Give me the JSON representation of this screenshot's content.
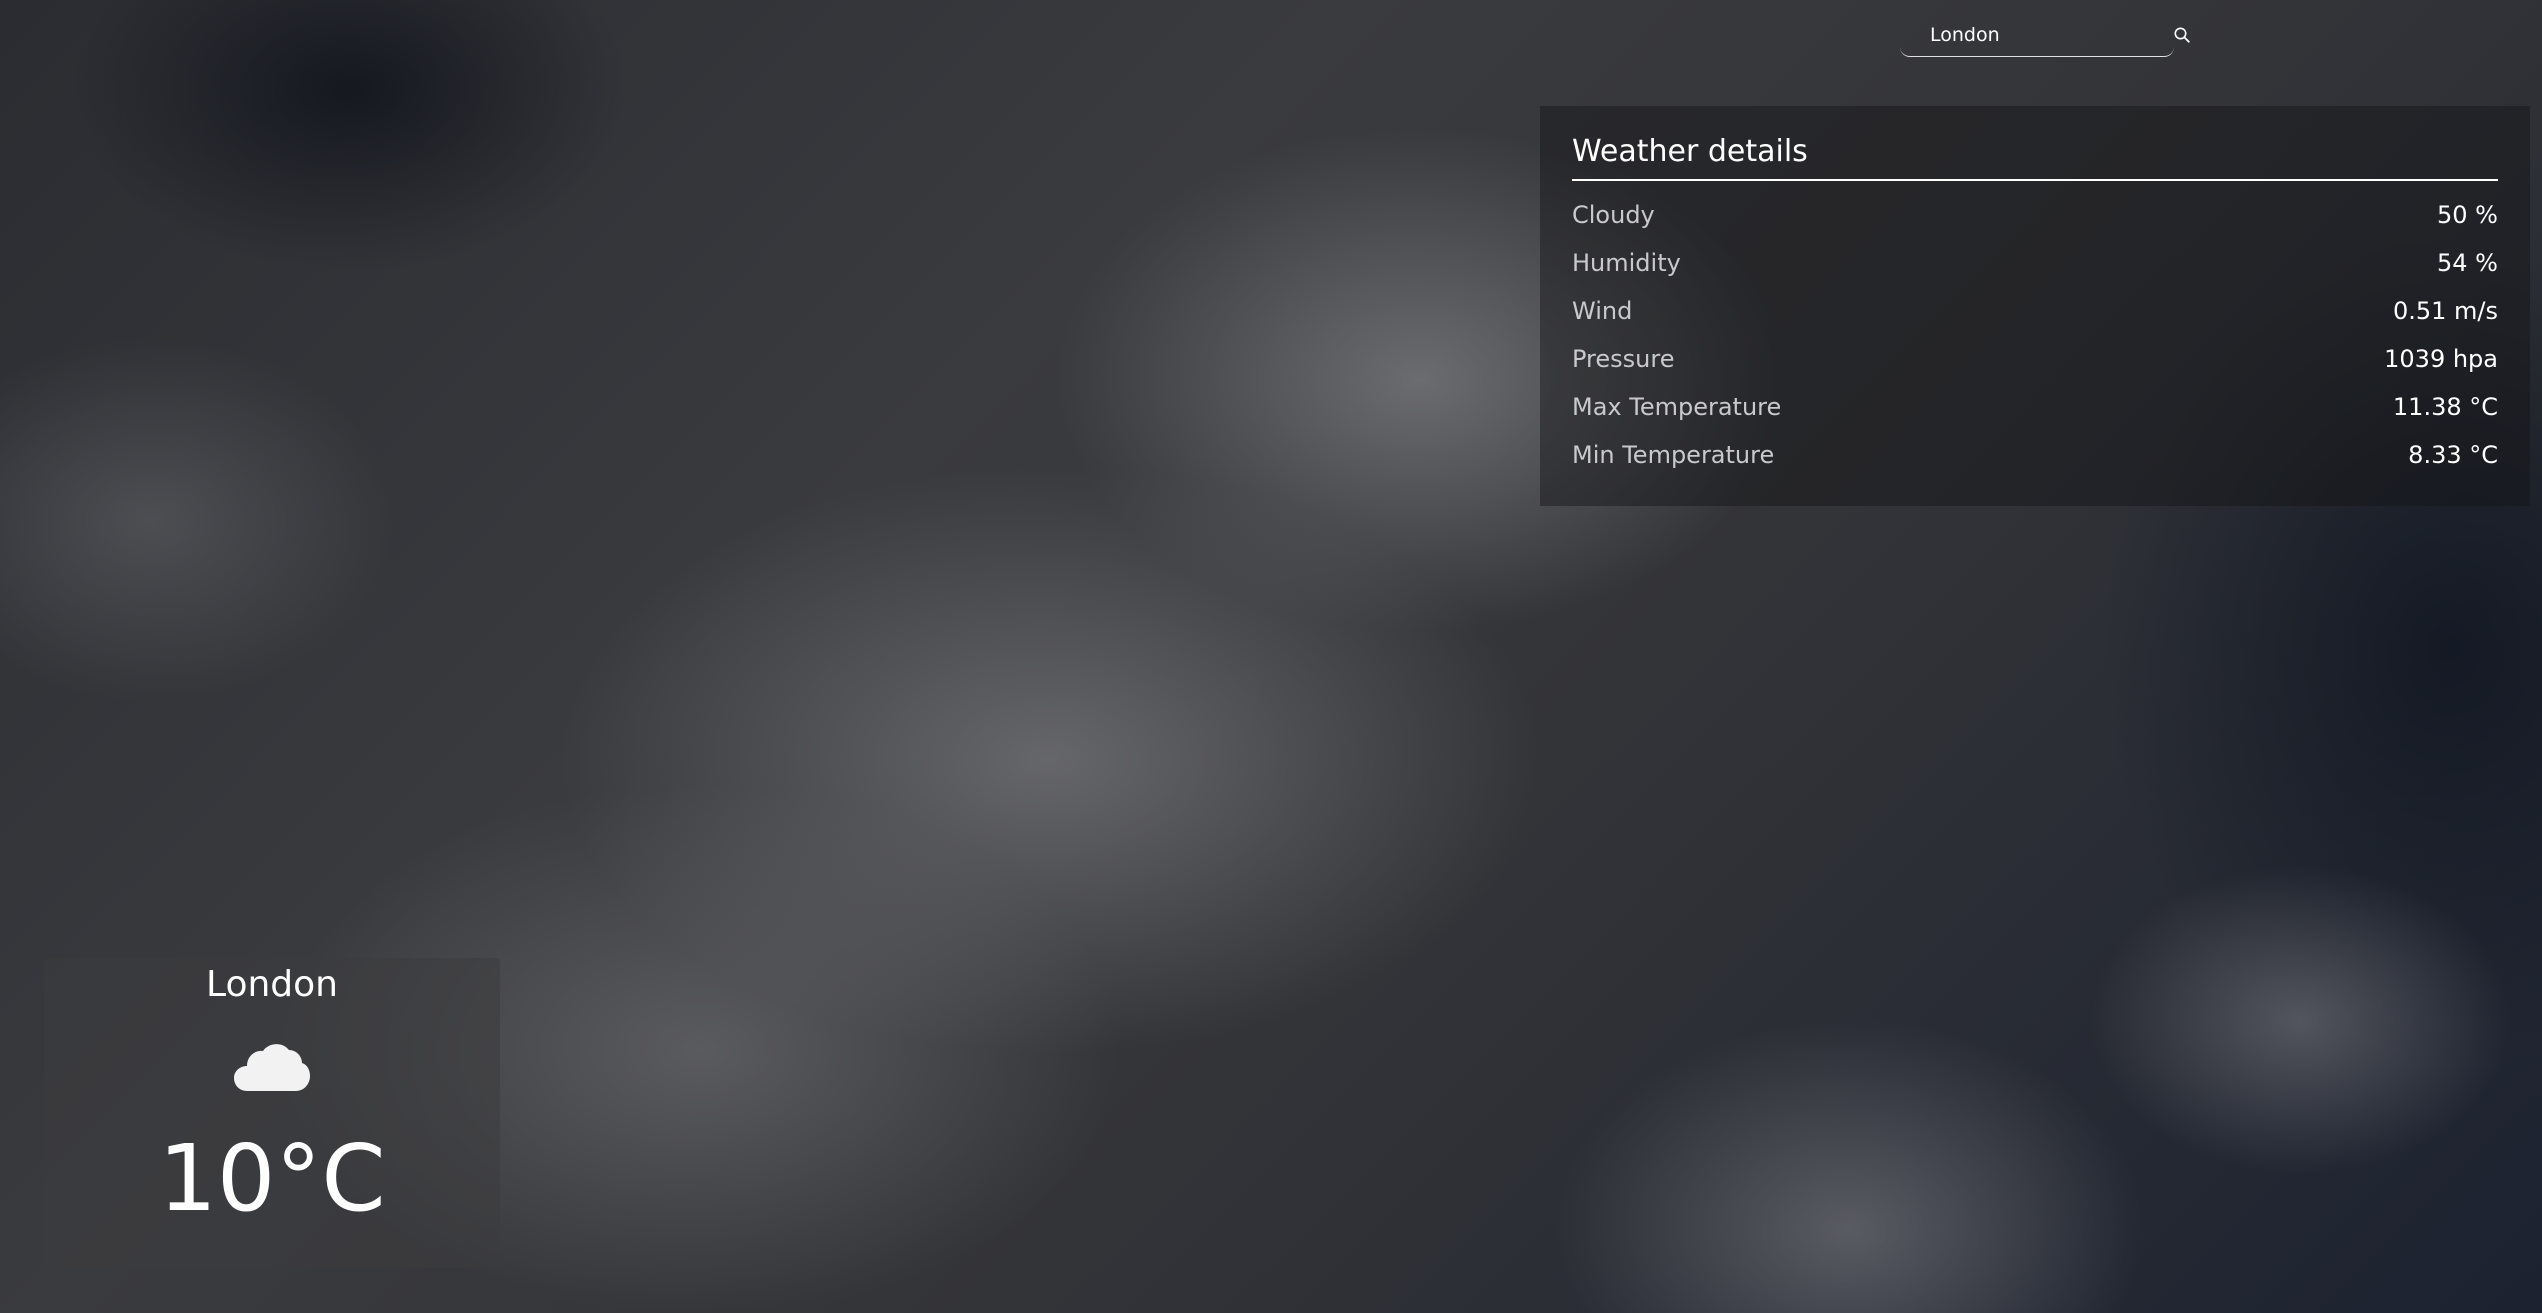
{
  "search": {
    "value": "London"
  },
  "details": {
    "title": "Weather details",
    "rows": [
      {
        "label": "Cloudy",
        "value": "50 %"
      },
      {
        "label": "Humidity",
        "value": "54 %"
      },
      {
        "label": "Wind",
        "value": "0.51 m/s"
      },
      {
        "label": "Pressure",
        "value": "1039 hpa"
      },
      {
        "label": "Max Temperature",
        "value": "11.38 °C"
      },
      {
        "label": "Min Temperature",
        "value": "8.33 °C"
      }
    ]
  },
  "current": {
    "city": "London",
    "condition_icon": "cloud-icon",
    "temperature": "10°C"
  },
  "icons": {
    "search": "search-icon"
  }
}
